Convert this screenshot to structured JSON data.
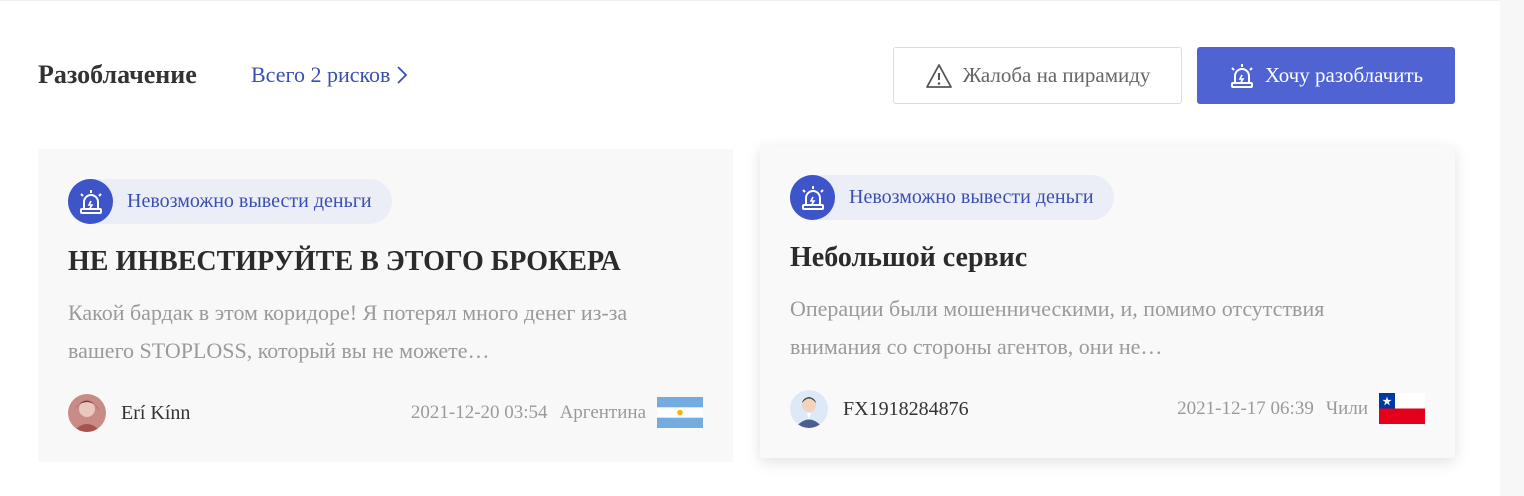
{
  "section": {
    "title": "Разоблачение",
    "total_link": "Всего 2 рисков",
    "complain_button": "Жалоба на пирамиду",
    "expose_button": "Хочу разоблачить"
  },
  "cards": [
    {
      "tag": "Невозможно вывести деньги",
      "title": "НЕ ИНВЕСТИРУЙТЕ В ЭТОГО БРОКЕРА",
      "excerpt": "Какой бардак в этом коридоре! Я потерял много денег из-за вашего STOPLOSS, который вы не можете…",
      "author": "Erí Kínn",
      "datetime": "2021-12-20 03:54",
      "country": "Аргентина",
      "flag_icon": "argentina-flag-icon"
    },
    {
      "tag": "Невозможно вывести деньги",
      "title": "Небольшой сервис",
      "excerpt": "Операции были мошенническими, и, помимо отсутствия внимания со стороны агентов, они не…",
      "author": "FX1918284876",
      "datetime": "2021-12-17 06:39",
      "country": "Чили",
      "flag_icon": "chile-flag-icon"
    }
  ],
  "colors": {
    "accent": "#4f63d2",
    "tag_bg": "#eceef7",
    "link": "#3a4fb0"
  }
}
